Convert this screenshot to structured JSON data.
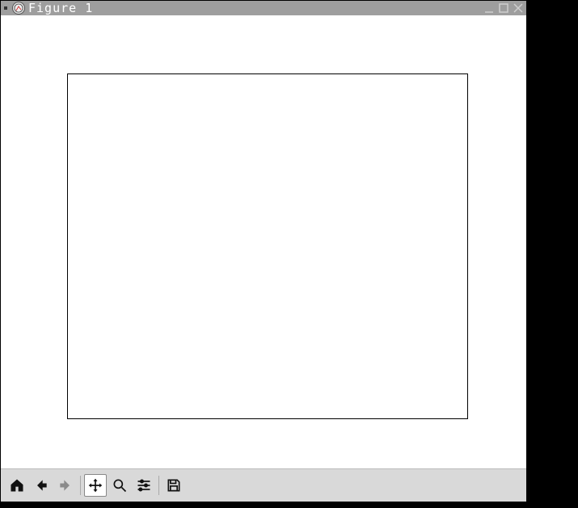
{
  "window": {
    "title": "Figure 1"
  },
  "toolbar": {
    "home": "Home",
    "back": "Back",
    "forward": "Forward",
    "pan": "Pan",
    "zoom": "Zoom",
    "subplots": "Configure subplots",
    "save": "Save"
  },
  "chart_data": {
    "type": "line",
    "title": "",
    "xlabel": "",
    "ylabel": "",
    "xlim": [
      0,
      1
    ],
    "ylim": [
      0,
      1
    ],
    "series": []
  }
}
